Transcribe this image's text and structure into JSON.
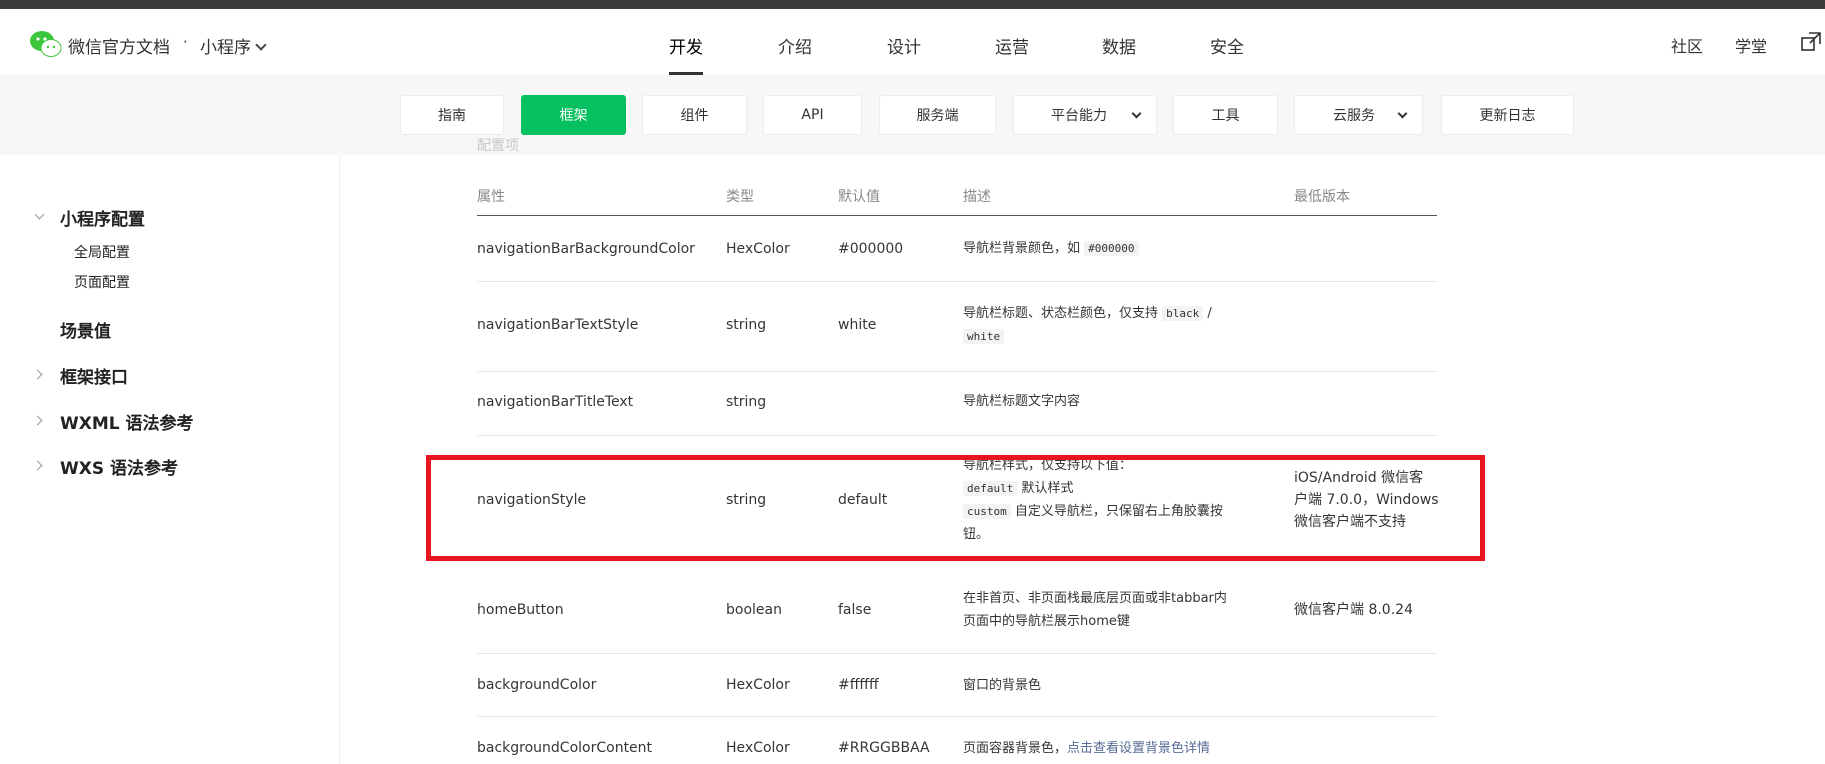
{
  "header": {
    "brand": "微信官方文档",
    "separator": "·",
    "product": "小程序",
    "nav": [
      "开发",
      "介绍",
      "设计",
      "运营",
      "数据",
      "安全"
    ],
    "right_links": [
      "社区",
      "学堂"
    ]
  },
  "subnav": {
    "items": [
      "指南",
      "框架",
      "组件",
      "API",
      "服务端",
      "平台能力",
      "工具",
      "云服务",
      "更新日志"
    ],
    "active": "框架"
  },
  "sidebar": {
    "section_open": "小程序配置",
    "sub_items": [
      "全局配置",
      "页面配置"
    ],
    "items": [
      "场景值",
      "框架接口",
      "WXML 语法参考",
      "WXS 语法参考"
    ]
  },
  "content": {
    "partial_heading": "配置项",
    "table": {
      "headers": [
        "属性",
        "类型",
        "默认值",
        "描述",
        "最低版本"
      ],
      "rows": [
        {
          "prop": "navigationBarBackgroundColor",
          "type": "HexColor",
          "default": "#000000",
          "desc_text": "导航栏背景颜色，如",
          "desc_code": "#000000",
          "version": ""
        },
        {
          "prop": "navigationBarTextStyle",
          "type": "string",
          "default": "white",
          "desc_text": "导航栏标题、状态栏颜色，仅支持",
          "desc_code1": "black",
          "desc_sep": "/",
          "desc_code2": "white",
          "version": ""
        },
        {
          "prop": "navigationBarTitleText",
          "type": "string",
          "default": "",
          "desc_text": "导航栏标题文字内容",
          "version": ""
        },
        {
          "prop": "navigationStyle",
          "type": "string",
          "default": "default",
          "desc_line1": "导航栏样式，仅支持以下值：",
          "desc_code1": "default",
          "desc_code1_text": "默认样式",
          "desc_code2": "custom",
          "desc_code2_text": "自定义导航栏，只保留右上角胶囊按",
          "desc_line4": "钮。",
          "version_l1": "iOS/Android 微信客",
          "version_l2": "户端 7.0.0，Windows",
          "version_l3": "微信客户端不支持"
        },
        {
          "prop": "homeButton",
          "type": "boolean",
          "default": "false",
          "desc_l1": "在非首页、非页面栈最底层页面或非tabbar内",
          "desc_l2": "页面中的导航栏展示home键",
          "version": "微信客户端 8.0.24"
        },
        {
          "prop": "backgroundColor",
          "type": "HexColor",
          "default": "#ffffff",
          "desc_text": "窗口的背景色",
          "version": ""
        },
        {
          "prop": "backgroundColorContent",
          "type": "HexColor",
          "default": "#RRGGBBAA",
          "desc_text": "页面容器背景色，",
          "desc_link": "点击查看设置背景色详情",
          "version": ""
        }
      ]
    }
  },
  "colors": {
    "accent": "#07c160",
    "highlight": "#e8141f",
    "link": "#576b95"
  }
}
